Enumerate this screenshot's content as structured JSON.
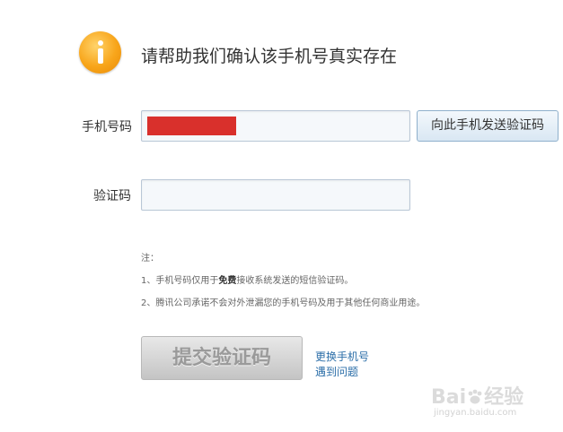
{
  "header": {
    "icon": "info-icon",
    "title": "请帮助我们确认该手机号真实存在"
  },
  "form": {
    "phone_label": "手机号码",
    "phone_value_redacted": true,
    "send_button_label": "向此手机发送验证码",
    "code_label": "验证码",
    "code_value": ""
  },
  "notes": {
    "heading": "注：",
    "line1_prefix": "1、手机号码仅用于",
    "line1_bold": "免费",
    "line1_suffix": "接收系统发送的短信验证码。",
    "line2": "2、腾讯公司承诺不会对外泄漏您的手机号码及用于其他任何商业用途。"
  },
  "actions": {
    "submit_label": "提交验证码",
    "change_phone_link": "更换手机号",
    "problem_link": "遇到问题"
  },
  "watermark": {
    "brand_part1": "Bai",
    "brand_part2": "经验",
    "url": "jingyan.baidu.com"
  },
  "colors": {
    "icon_orange": "#f8a51a",
    "redaction_red": "#d9302c",
    "link_blue": "#2b6ea8"
  }
}
